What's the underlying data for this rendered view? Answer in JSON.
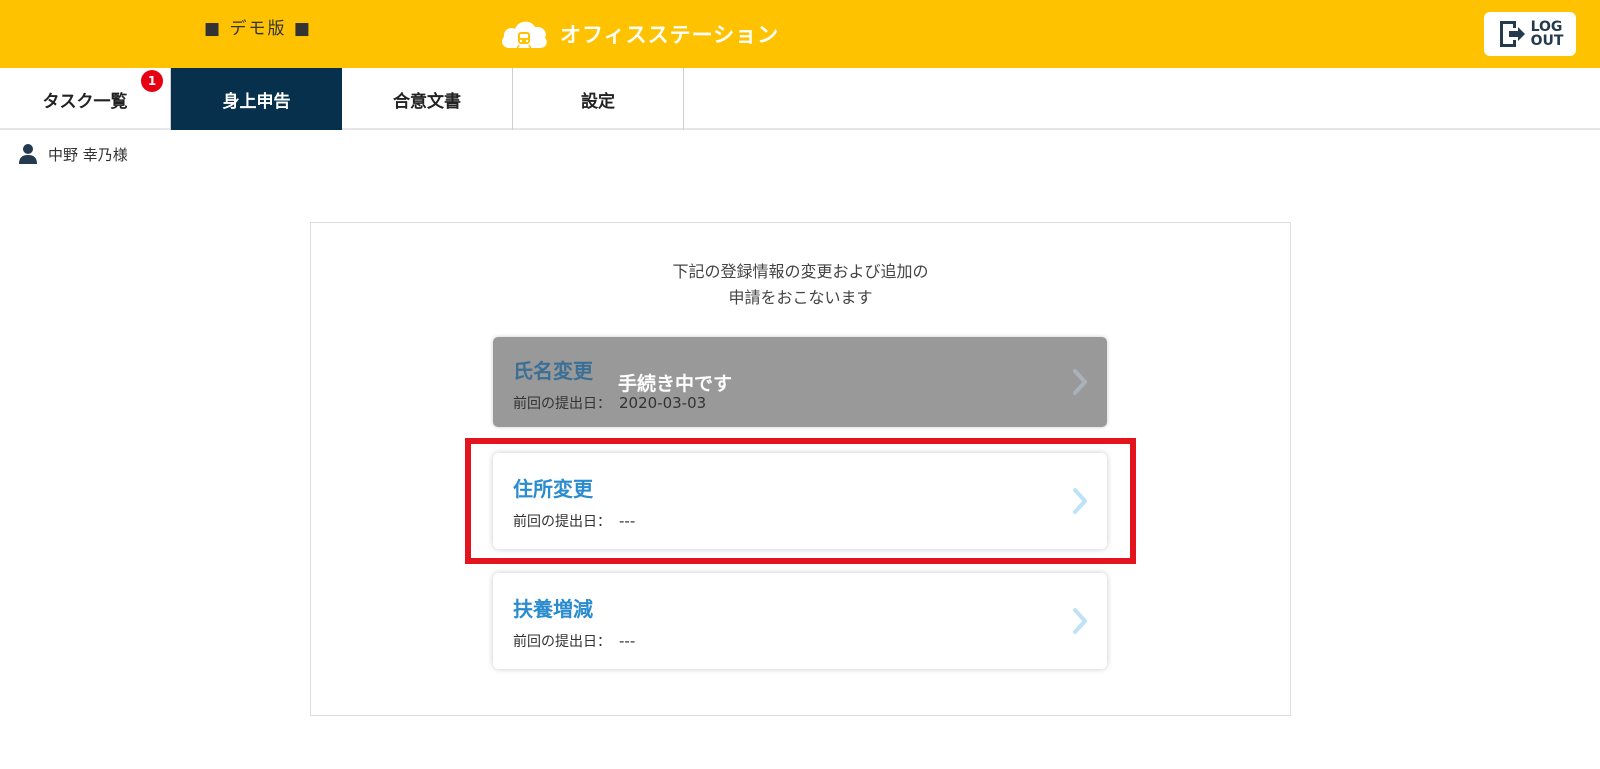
{
  "header": {
    "demo_label": "■ デモ版 ■",
    "brand_name": "オフィスステーション",
    "logout": {
      "line1": "LOG",
      "line2": "OUT"
    },
    "colors": {
      "background": "#ffc200",
      "text": "#ffffff"
    }
  },
  "tabs": [
    {
      "label": "タスク一覧",
      "badge": "1",
      "active": false
    },
    {
      "label": "身上申告",
      "active": true
    },
    {
      "label": "合意文書",
      "active": false
    },
    {
      "label": "設定",
      "active": false
    }
  ],
  "user": {
    "name": "中野 幸乃様",
    "icon": "person-icon"
  },
  "main": {
    "intro_line1": "下記の登録情報の変更および追加の",
    "intro_line2": "申請をおこないます",
    "cards": [
      {
        "title": "氏名変更",
        "status": "手続き中です",
        "sub_label": "前回の提出日：",
        "sub_value": "2020-03-03",
        "disabled": true
      },
      {
        "title": "住所変更",
        "sub_label": "前回の提出日：",
        "sub_value": "---",
        "disabled": false,
        "highlighted": true
      },
      {
        "title": "扶養増減",
        "sub_label": "前回の提出日：",
        "sub_value": "---",
        "disabled": false
      }
    ]
  },
  "colors": {
    "active_tab": "#06304b",
    "badge": "#e60012",
    "card_title": "#2a8ccf",
    "highlight": "#e3141d"
  }
}
